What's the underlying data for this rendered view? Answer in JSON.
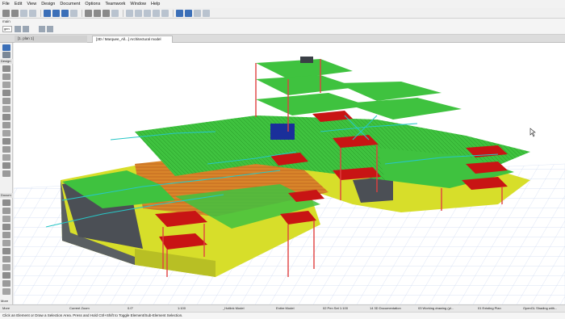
{
  "menu": {
    "items": [
      "File",
      "Edit",
      "View",
      "Design",
      "Document",
      "Options",
      "Teamwork",
      "Window",
      "Help"
    ]
  },
  "infobox": {
    "label": "main",
    "selector": "gen"
  },
  "tabs": {
    "floor_plan": "[1. plan 1]",
    "model_3d": "[3D / Marquee_All...] Architectural model"
  },
  "toolbox": {
    "design_header": "Design",
    "document_header": "Docum",
    "more_label": "More"
  },
  "statusbar": {
    "current_zoom": "Current Zoom",
    "angle": "0.0°",
    "scale": "1:100",
    "layer_combo": "_Hotlink Model",
    "model_view": "Entire Model",
    "pen_set": "02 Pen Set 1:100",
    "doc_set": "14 3D Documentation",
    "drawing_set": "03 Working drawing (pl...",
    "renovation": "01 Existing Plan",
    "engine": "OpenGL Shading with..."
  },
  "hint": {
    "text": "Click an Element or Draw a Selection Area. Press and Hold Ctrl+Shift to Toggle Element/Sub-Element Selection."
  },
  "colors": {
    "slab_green": "#3fc23f",
    "slab_yellow": "#d7de2a",
    "slab_orange": "#d9852a",
    "roof_red": "#c81414",
    "column_red": "#e04040",
    "beam_cyan": "#27c6c6",
    "grid_blue": "#c9d6ef",
    "accent_blue": "#3b6fb8"
  }
}
